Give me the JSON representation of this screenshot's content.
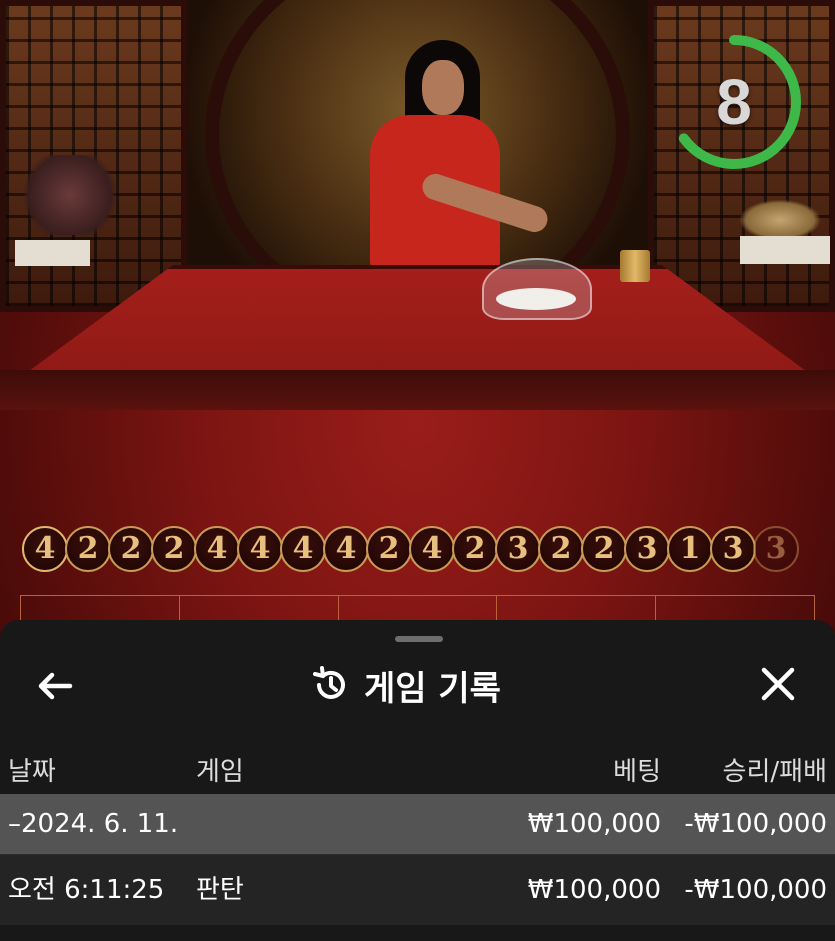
{
  "timer": {
    "value": "8",
    "progress": 0.65,
    "color": "#3fb84a"
  },
  "results_road": {
    "values": [
      "4",
      "2",
      "2",
      "2",
      "4",
      "4",
      "4",
      "4",
      "2",
      "4",
      "2",
      "3",
      "2",
      "2",
      "3",
      "1",
      "3",
      "3"
    ]
  },
  "sheet": {
    "title": "게임 기록",
    "title_icon": "history-icon",
    "back_icon": "arrow-left-icon",
    "close_icon": "close-icon"
  },
  "history": {
    "columns": {
      "date": "날짜",
      "game": "게임",
      "bet": "베팅",
      "result": "승리/패배"
    },
    "date_group": "–2024. 6. 11.",
    "date_group_bet": "₩100,000",
    "date_group_result": "-₩100,000",
    "rows": [
      {
        "time": "오전 6:11:25",
        "game": "판탄",
        "bet": "₩100,000",
        "result": "-₩100,000"
      }
    ]
  },
  "colors": {
    "sheet_bg": "#181818",
    "date_row_bg": "#545454",
    "road_gold": "#e7c07e",
    "felt_red": "#a51f1b"
  }
}
